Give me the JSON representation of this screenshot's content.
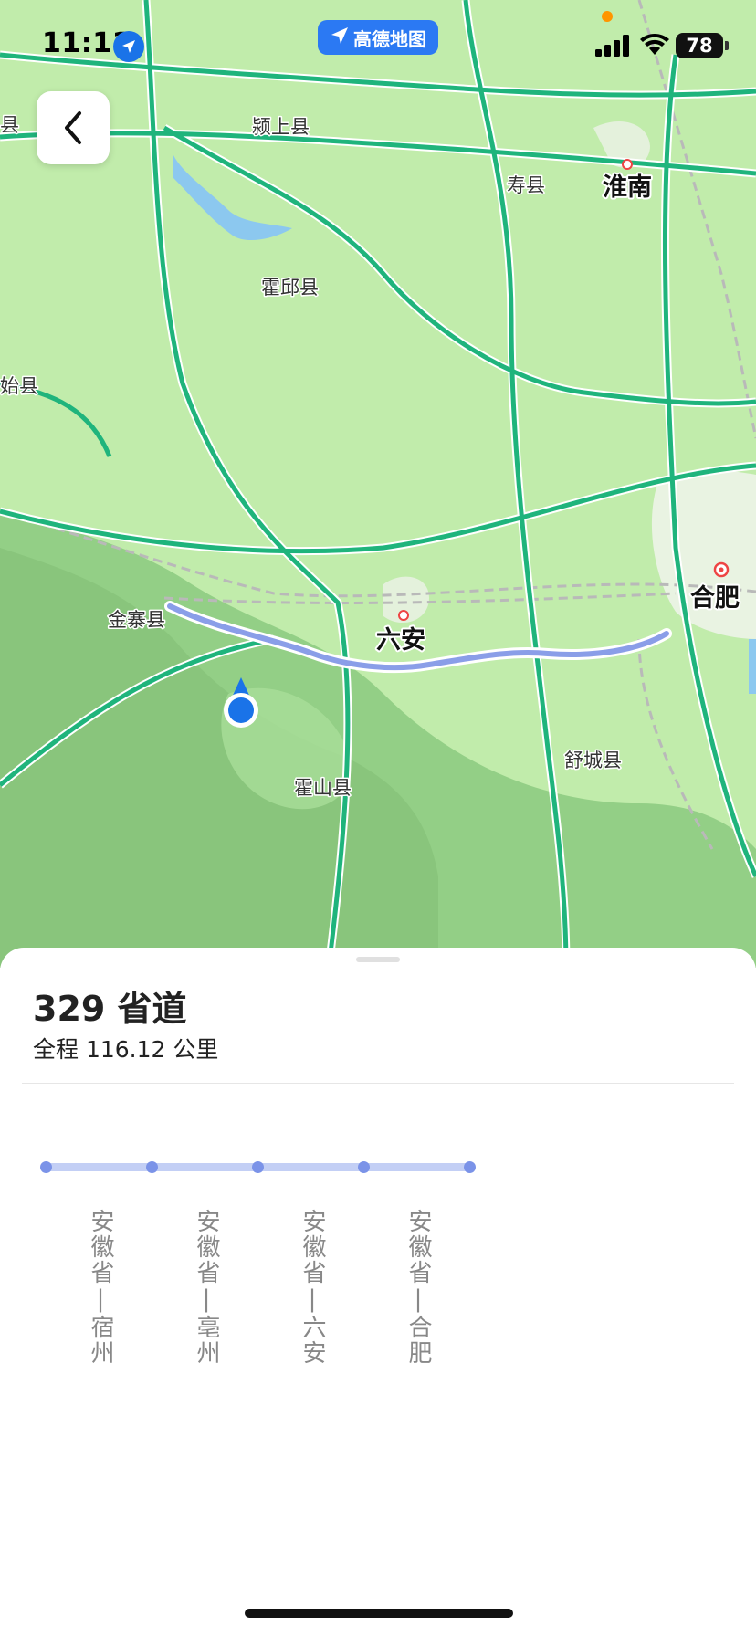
{
  "status_bar": {
    "time": "11:11",
    "battery": "78",
    "app_badge": "高德地图"
  },
  "map": {
    "place_labels": [
      {
        "id": "yingshang",
        "name": "颍上县"
      },
      {
        "id": "shouxian",
        "name": "寿县"
      },
      {
        "id": "huainan",
        "name": "淮南"
      },
      {
        "id": "huoqiu",
        "name": "霍邱县"
      },
      {
        "id": "gushi",
        "name": "始县"
      },
      {
        "id": "jinzhai",
        "name": "金寨县"
      },
      {
        "id": "liuan",
        "name": "六安"
      },
      {
        "id": "hefei",
        "name": "合肥"
      },
      {
        "id": "shucheng",
        "name": "舒城县"
      },
      {
        "id": "huoshan",
        "name": "霍山县"
      },
      {
        "id": "edge_county",
        "name": "县"
      }
    ],
    "colors": {
      "land": "#c1ecab",
      "mountain": "#93cf86",
      "highway": "#1fb47c",
      "route": "#8a9ee8",
      "location": "#1a73e8",
      "water": "#8cc8ef"
    }
  },
  "route": {
    "road_name": "329 省道",
    "distance": "全程 116.12 公里",
    "stops": [
      {
        "label": "安徽省|宿州"
      },
      {
        "label": "安徽省|亳州"
      },
      {
        "label": "安徽省|六安"
      },
      {
        "label": "安徽省|合肥"
      }
    ]
  }
}
